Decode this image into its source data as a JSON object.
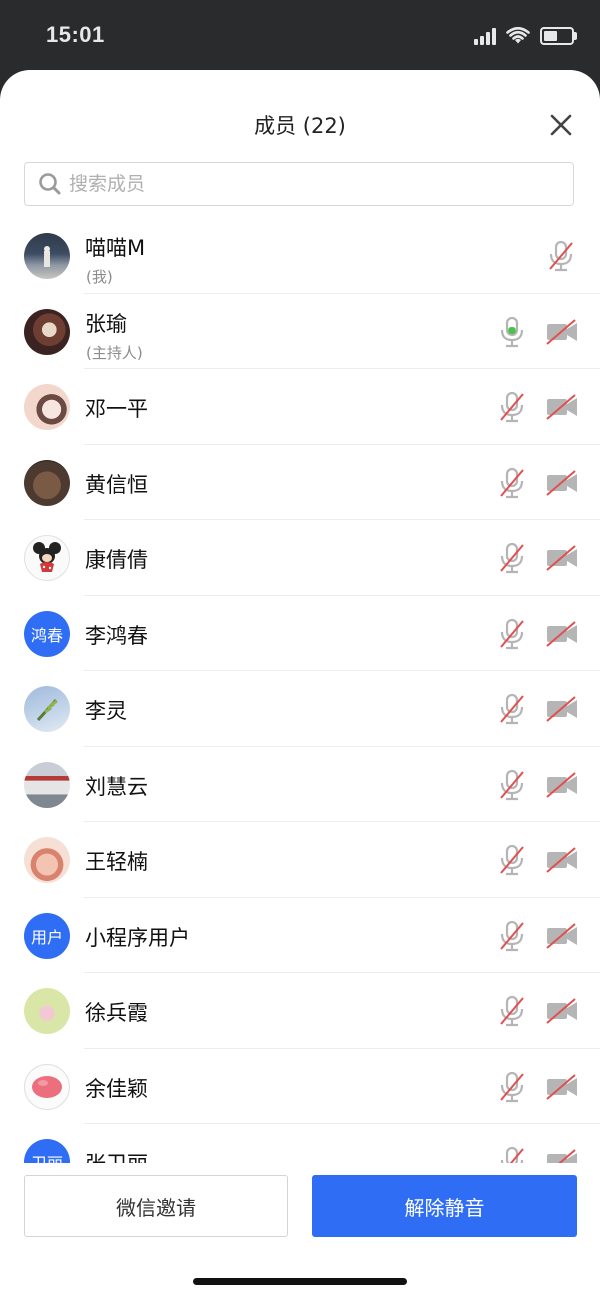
{
  "status": {
    "time": "15:01"
  },
  "panel": {
    "title": "成员 (22)"
  },
  "search": {
    "placeholder": "搜索成员"
  },
  "colors": {
    "accent": "#2f6df5",
    "mic_active": "#4cc24c",
    "muted_strike": "#e05050"
  },
  "members": [
    {
      "name": "喵喵M",
      "sub": "(我)",
      "avatar": "photo-dark-landscape",
      "mic": "muted",
      "cam": "none"
    },
    {
      "name": "张瑜",
      "sub": "(主持人)",
      "avatar": "photo-dog",
      "mic": "active",
      "cam": "off"
    },
    {
      "name": "邓一平",
      "avatar": "illustration-girl",
      "mic": "muted",
      "cam": "off"
    },
    {
      "name": "黄信恒",
      "avatar": "photo-teddy-bear",
      "mic": "muted",
      "cam": "off"
    },
    {
      "name": "康倩倩",
      "avatar": "minnie-mouse",
      "mic": "muted",
      "cam": "off"
    },
    {
      "name": "李鸿春",
      "avatar_text": "鸿春",
      "mic": "muted",
      "cam": "off"
    },
    {
      "name": "李灵",
      "avatar": "photo-sky-plant",
      "mic": "muted",
      "cam": "off"
    },
    {
      "name": "刘慧云",
      "avatar": "photo-building",
      "mic": "muted",
      "cam": "off"
    },
    {
      "name": "王轻楠",
      "avatar": "photo-child",
      "mic": "muted",
      "cam": "off"
    },
    {
      "name": "小程序用户",
      "avatar_text": "用户",
      "mic": "muted",
      "cam": "off"
    },
    {
      "name": "徐兵霞",
      "avatar": "illustration-flowers",
      "mic": "muted",
      "cam": "off"
    },
    {
      "name": "余佳颖",
      "avatar": "illustration-pink-blob",
      "mic": "muted",
      "cam": "off"
    },
    {
      "name": "张卫丽",
      "avatar_text": "卫丽",
      "mic": "muted",
      "cam": "off"
    }
  ],
  "footer": {
    "invite_label": "微信邀请",
    "unmute_label": "解除静音"
  }
}
